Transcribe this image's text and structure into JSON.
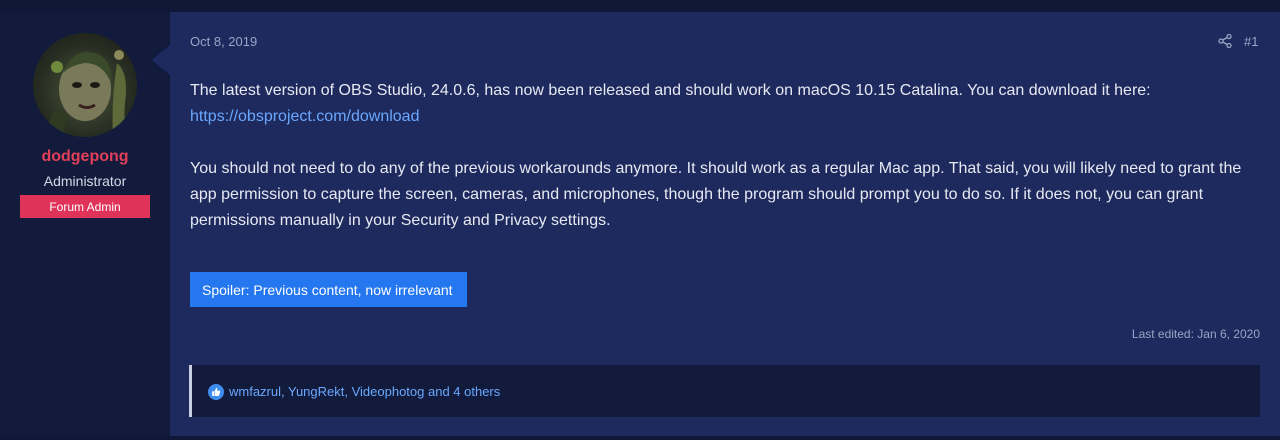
{
  "user": {
    "username": "dodgepong",
    "title": "Administrator",
    "banner": "Forum Admin",
    "avatar_icon": "avatar-image"
  },
  "post": {
    "date": "Oct 8, 2019",
    "number": "#1",
    "share_icon": "share-icon",
    "paragraph1": "The latest version of OBS Studio, 24.0.6, has now been released and should work on macOS 10.15 Catalina. You can download it here:",
    "download_link": "https://obsproject.com/download",
    "paragraph2": "You should not need to do any of the previous workarounds anymore. It should work as a regular Mac app. That said, you will likely need to grant the app permission to capture the screen, cameras, and microphones, though the program should prompt you to do so. If it does not, you can grant permissions manually in your Security and Privacy settings.",
    "spoiler_label": "Spoiler: Previous content, now irrelevant",
    "last_edited": "Last edited: Jan 6, 2020",
    "reactions": "wmfazrul, YungRekt, Videophotog and 4 others",
    "reaction_icon": "like-icon"
  },
  "colors": {
    "page_bg": "#0f1836",
    "post_bg": "#1e2a5e",
    "username": "#e23f5a",
    "banner": "#e0335a",
    "link": "#6aa8ff",
    "spoiler_button": "#2577f0"
  }
}
